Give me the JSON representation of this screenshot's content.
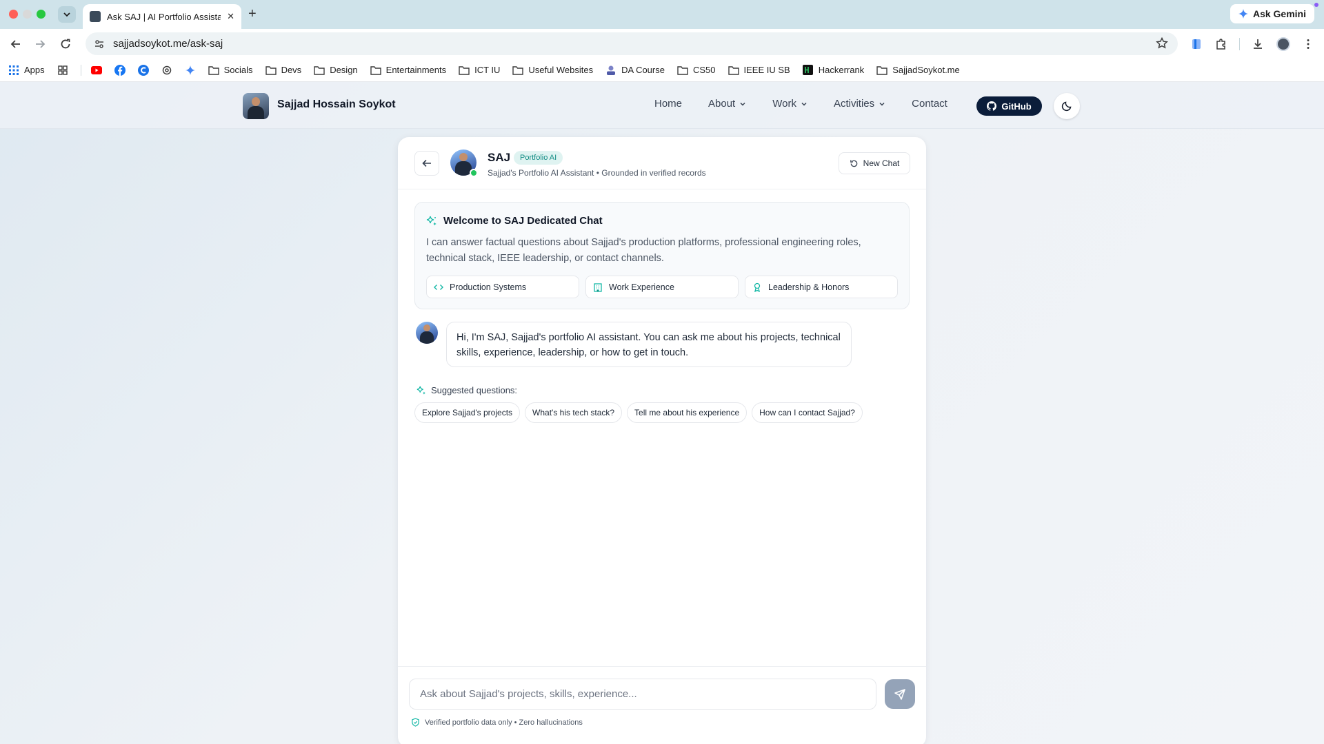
{
  "browser": {
    "tab_title": "Ask SAJ | AI Portfolio Assistant",
    "url": "sajjadsoykot.me/ask-saj",
    "gemini_label": "Ask Gemini",
    "bookmarks": {
      "apps": "Apps",
      "socials": "Socials",
      "devs": "Devs",
      "design": "Design",
      "entertainments": "Entertainments",
      "ict_iu": "ICT IU",
      "useful": "Useful Websites",
      "da_course": "DA Course",
      "cs50": "CS50",
      "ieee": "IEEE IU SB",
      "hackerrank": "Hackerrank",
      "sajjad": "SajjadSoykot.me"
    }
  },
  "site": {
    "name": "Sajjad Hossain Soykot",
    "nav": {
      "home": "Home",
      "about": "About",
      "work": "Work",
      "activities": "Activities",
      "contact": "Contact"
    },
    "github_label": "GitHub"
  },
  "chat": {
    "assistant_name": "SAJ",
    "badge": "Portfolio AI",
    "subtitle": "Sajjad's Portfolio AI Assistant • Grounded in verified records",
    "new_chat": "New Chat",
    "welcome": {
      "title": "Welcome to SAJ Dedicated Chat",
      "description": "I can answer factual questions about Sajjad's production platforms, professional engineering roles, technical stack, IEEE leadership, or contact channels.",
      "chips": {
        "production": "Production Systems",
        "work": "Work Experience",
        "leadership": "Leadership & Honors"
      }
    },
    "message": "Hi, I'm SAJ, Sajjad's portfolio AI assistant. You can ask me about his projects, technical skills, experience, leadership, or how to get in touch.",
    "suggested_label": "Suggested questions:",
    "suggestions": {
      "projects": "Explore Sajjad's projects",
      "stack": "What's his tech stack?",
      "experience": "Tell me about his experience",
      "contact": "How can I contact Sajjad?"
    },
    "input_placeholder": "Ask about Sajjad's projects, skills, experience...",
    "footer_note": "Verified portfolio data only • Zero hallucinations"
  },
  "colors": {
    "accent": "#14b8a6",
    "github_bg": "#0b1d3a",
    "online": "#22c55e",
    "send_disabled": "#94a3b8"
  }
}
